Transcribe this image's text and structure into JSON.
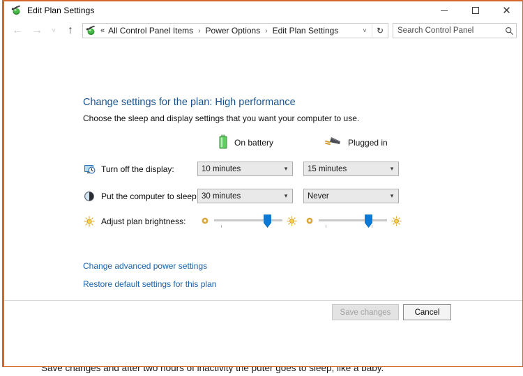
{
  "window": {
    "title": "Edit Plan Settings",
    "icon": "power-plan-icon",
    "accent_color": "#d4662a",
    "controls": {
      "minimize": "minimize-button",
      "maximize": "maximize-button",
      "close": "close-button"
    }
  },
  "navbar": {
    "back": "←",
    "forward": "→",
    "recent": "˅",
    "up": "↑",
    "address": {
      "icon": "power-plan-icon",
      "overflow": "«",
      "crumbs": [
        "All Control Panel Items",
        "Power Options",
        "Edit Plan Settings"
      ],
      "separator": "›",
      "dropdown": "˅",
      "refresh": "↻"
    },
    "search": {
      "placeholder": "Search Control Panel",
      "value": "",
      "icon": "search-icon"
    }
  },
  "page": {
    "title": "Change settings for the plan: High performance",
    "subtitle": "Choose the sleep and display settings that you want your computer to use.",
    "plan_name": "High performance"
  },
  "columns": [
    {
      "id": "on-battery",
      "label": "On battery",
      "icon": "battery-icon"
    },
    {
      "id": "plugged-in",
      "label": "Plugged in",
      "icon": "power-plug-icon"
    }
  ],
  "settings": [
    {
      "id": "turn-off-display",
      "label": "Turn off the display:",
      "icon": "display-clock-icon",
      "type": "dropdown",
      "on_battery": "10 minutes",
      "plugged_in": "15 minutes"
    },
    {
      "id": "put-computer-to-sleep",
      "label": "Put the computer to sleep:",
      "icon": "sleep-icon",
      "type": "dropdown",
      "on_battery": "30 minutes",
      "plugged_in": "Never"
    },
    {
      "id": "adjust-plan-brightness",
      "label": "Adjust plan brightness:",
      "icon": "brightness-icon",
      "type": "slider",
      "on_battery_percent": 78,
      "plugged_in_percent": 72,
      "low_icon": "dim-brightness-icon",
      "high_icon": "high-brightness-icon"
    }
  ],
  "links": [
    {
      "id": "change-advanced-power-settings",
      "label": "Change advanced power settings"
    },
    {
      "id": "restore-default-settings",
      "label": "Restore default settings for this plan"
    }
  ],
  "footer": {
    "save_label": "Save changes",
    "save_enabled": false,
    "cancel_label": "Cancel"
  },
  "background": {
    "caption": "Save changes and after two hours of inactivity the puter goes to sleep, like a baby."
  }
}
